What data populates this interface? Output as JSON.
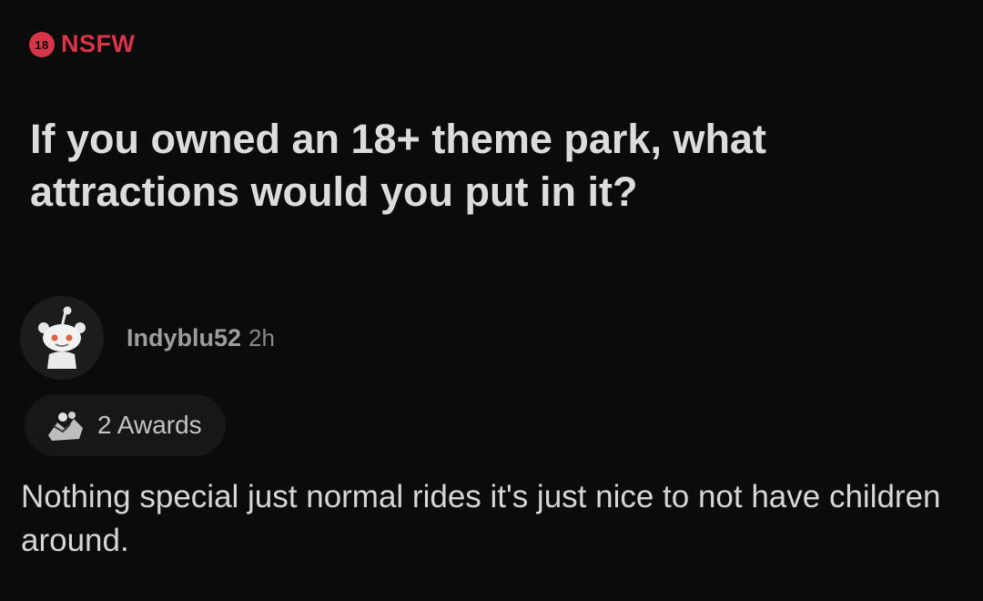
{
  "post": {
    "nsfw_badge_number": "18",
    "nsfw_label": "NSFW",
    "title": "If you owned an 18+ theme park, what attractions would you put in it?"
  },
  "comment": {
    "author": "Indyblu52",
    "timestamp": "2h",
    "awards_label": "2 Awards",
    "body": "Nothing special just normal rides it's just nice to not have children around."
  },
  "colors": {
    "background": "#0b0b0b",
    "nsfw_red": "#d8354b",
    "title_text": "#dcdcdc",
    "muted_text": "#9d9d9d"
  },
  "icons": {
    "nsfw": "nsfw-18-badge-icon",
    "avatar": "snoo-avatar-icon",
    "awards": "award-icon"
  }
}
